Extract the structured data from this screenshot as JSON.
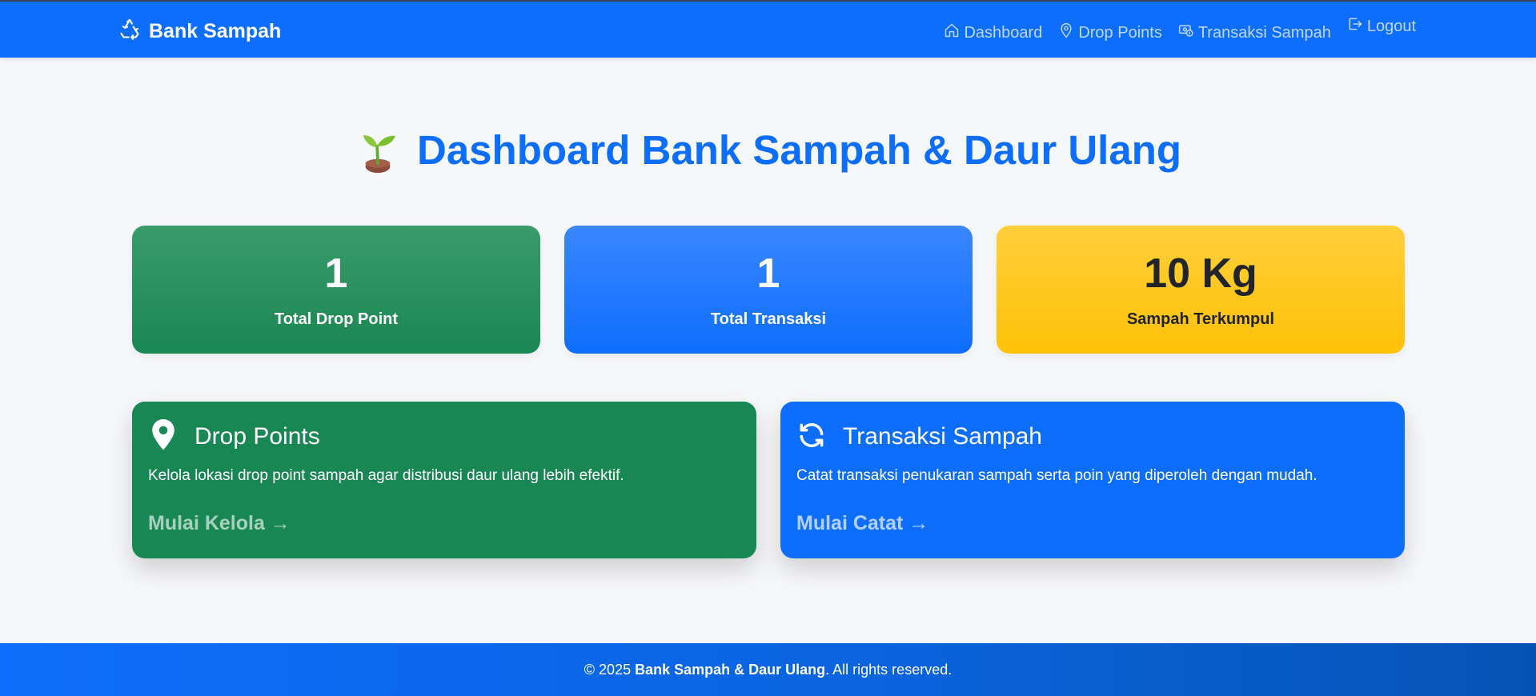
{
  "navbar": {
    "brand": "Bank Sampah",
    "links": [
      {
        "label": "Dashboard",
        "icon": "house-icon"
      },
      {
        "label": "Drop Points",
        "icon": "map-pin-icon"
      },
      {
        "label": "Transaksi Sampah",
        "icon": "cash-coin-icon"
      },
      {
        "label": "Logout",
        "icon": "logout-icon"
      }
    ]
  },
  "main": {
    "title": "Dashboard Bank Sampah & Daur Ulang",
    "title_icon": "seedling-icon",
    "stats": [
      {
        "value": "1",
        "label": "Total Drop Point",
        "color": "#198754"
      },
      {
        "value": "1",
        "label": "Total Transaksi",
        "color": "#0d6efd"
      },
      {
        "value": "10 Kg",
        "label": "Sampah Terkumpul",
        "color": "#ffc107"
      }
    ],
    "features": [
      {
        "title": "Drop Points",
        "icon": "map-pin-icon",
        "text": "Kelola lokasi drop point sampah agar distribusi daur ulang lebih efektif.",
        "link": "Mulai Kelola →",
        "color": "#198754"
      },
      {
        "title": "Transaksi Sampah",
        "icon": "refresh-icon",
        "text": "Catat transaksi penukaran sampah serta poin yang diperoleh dengan mudah.",
        "link": "Mulai Catat →",
        "color": "#0d6efd"
      }
    ]
  },
  "footer": {
    "prefix": "© 2025",
    "brand": "Bank Sampah & Daur Ulang",
    "suffix": ". All rights reserved."
  },
  "colors": {
    "primary": "#0d6efd",
    "success": "#198754",
    "warning": "#ffc107",
    "background": "#f6f7f9"
  }
}
